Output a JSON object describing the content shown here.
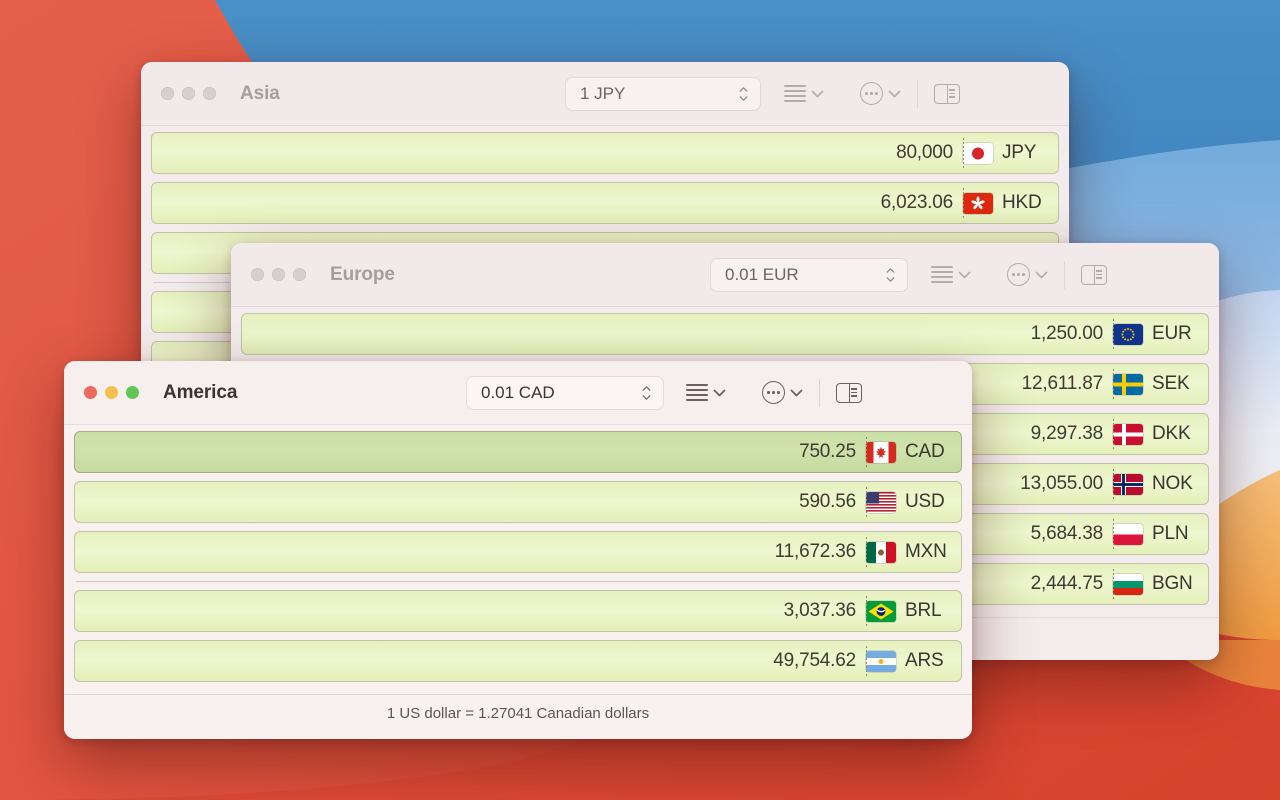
{
  "wallpaper": {
    "colors": {
      "blue_dark": "#3c86c4",
      "blue_mid": "#74aede",
      "blue_light": "#bed2f0",
      "white": "#f2f3f7",
      "orange": "#f0a24a",
      "red": "#e2543f",
      "red_deep": "#d8432f"
    }
  },
  "windows": [
    {
      "id": "asia",
      "title": "Asia",
      "active": false,
      "stepper_value": "1 JPY",
      "status_text": "",
      "rows": [
        {
          "amount": "80,000",
          "code": "JPY",
          "flag": "jp",
          "selected": false,
          "separator_after": false
        },
        {
          "amount": "6,023.06",
          "code": "HKD",
          "flag": "hk",
          "selected": false,
          "separator_after": false
        },
        {
          "amount": "",
          "code": "",
          "flag": "",
          "selected": false,
          "separator_after": true
        },
        {
          "amount": "",
          "code": "",
          "flag": "",
          "selected": false,
          "separator_after": false
        },
        {
          "amount": "",
          "code": "",
          "flag": "",
          "selected": false,
          "separator_after": false
        }
      ]
    },
    {
      "id": "europe",
      "title": "Europe",
      "active": false,
      "stepper_value": "0.01 EUR",
      "status_text": "",
      "rows": [
        {
          "amount": "1,250.00",
          "code": "EUR",
          "flag": "eu",
          "selected": false,
          "separator_after": false
        },
        {
          "amount": "12,611.87",
          "code": "SEK",
          "flag": "se",
          "selected": false,
          "separator_after": false
        },
        {
          "amount": "9,297.38",
          "code": "DKK",
          "flag": "dk",
          "selected": false,
          "separator_after": false
        },
        {
          "amount": "13,055.00",
          "code": "NOK",
          "flag": "no",
          "selected": false,
          "separator_after": false
        },
        {
          "amount": "5,684.38",
          "code": "PLN",
          "flag": "pl",
          "selected": false,
          "separator_after": false
        },
        {
          "amount": "2,444.75",
          "code": "BGN",
          "flag": "bg",
          "selected": false,
          "separator_after": false
        }
      ]
    },
    {
      "id": "america",
      "title": "America",
      "active": true,
      "stepper_value": "0.01 CAD",
      "status_text": "1 US dollar = 1.27041 Canadian dollars",
      "rows": [
        {
          "amount": "750.25",
          "code": "CAD",
          "flag": "ca",
          "selected": true,
          "separator_after": false
        },
        {
          "amount": "590.56",
          "code": "USD",
          "flag": "us",
          "selected": false,
          "separator_after": false
        },
        {
          "amount": "11,672.36",
          "code": "MXN",
          "flag": "mx",
          "selected": false,
          "separator_after": true
        },
        {
          "amount": "3,037.36",
          "code": "BRL",
          "flag": "br",
          "selected": false,
          "separator_after": false
        },
        {
          "amount": "49,754.62",
          "code": "ARS",
          "flag": "ar",
          "selected": false,
          "separator_after": false
        }
      ]
    }
  ],
  "toolbar": {
    "list_icon": "hamburger-list-icon",
    "more_icon": "circle-ellipsis-icon",
    "sidebar_icon": "sidebar-toggle-icon",
    "stepper_icon": "stepper-arrows-icon"
  },
  "traffic_lights": {
    "close": "close-button",
    "minimize": "minimize-button",
    "maximize": "maximize-button",
    "close_color": "#ec6a5e",
    "minimize_color": "#f4bf4f",
    "maximize_color": "#61c554"
  },
  "row_colors": {
    "normal": "#eef7cf",
    "selected": "#cfe2aa",
    "border": "#bfc5a8"
  }
}
